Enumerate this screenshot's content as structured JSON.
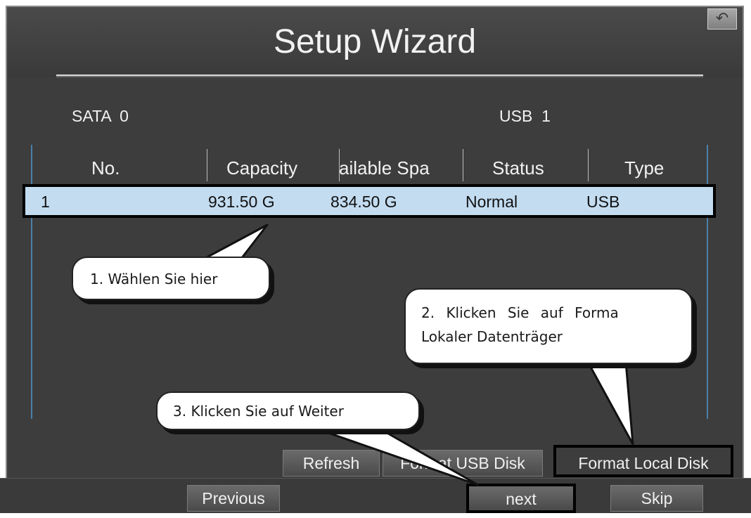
{
  "window": {
    "title": "Setup Wizard"
  },
  "disks": {
    "sata": "SATA  0",
    "usb": "USB  1"
  },
  "table": {
    "headers": [
      "No.",
      "Capacity",
      "ailable Spa",
      "Status",
      "Type"
    ],
    "rows": [
      {
        "no": "1",
        "capacity": "931.50 G",
        "available": "834.50 G",
        "status": "Normal",
        "type": "USB"
      }
    ]
  },
  "callouts": {
    "step1": "1. Wählen Sie hier",
    "step2_line1": "2. Klicken Sie auf Forma",
    "step2_line2": "Lokaler Datenträger",
    "step3": "3. Klicken Sie auf Weiter"
  },
  "buttons": {
    "refresh": "Refresh",
    "format_usb": "Format USB Disk",
    "format_local": "Format Local Disk",
    "previous": "Previous",
    "next": "next",
    "skip": "Skip",
    "back_icon": "back-arrow-icon"
  },
  "colors": {
    "background": "#3d3d3d",
    "selected_row": "#c3dcf0",
    "table_border": "#4b7fa8"
  }
}
